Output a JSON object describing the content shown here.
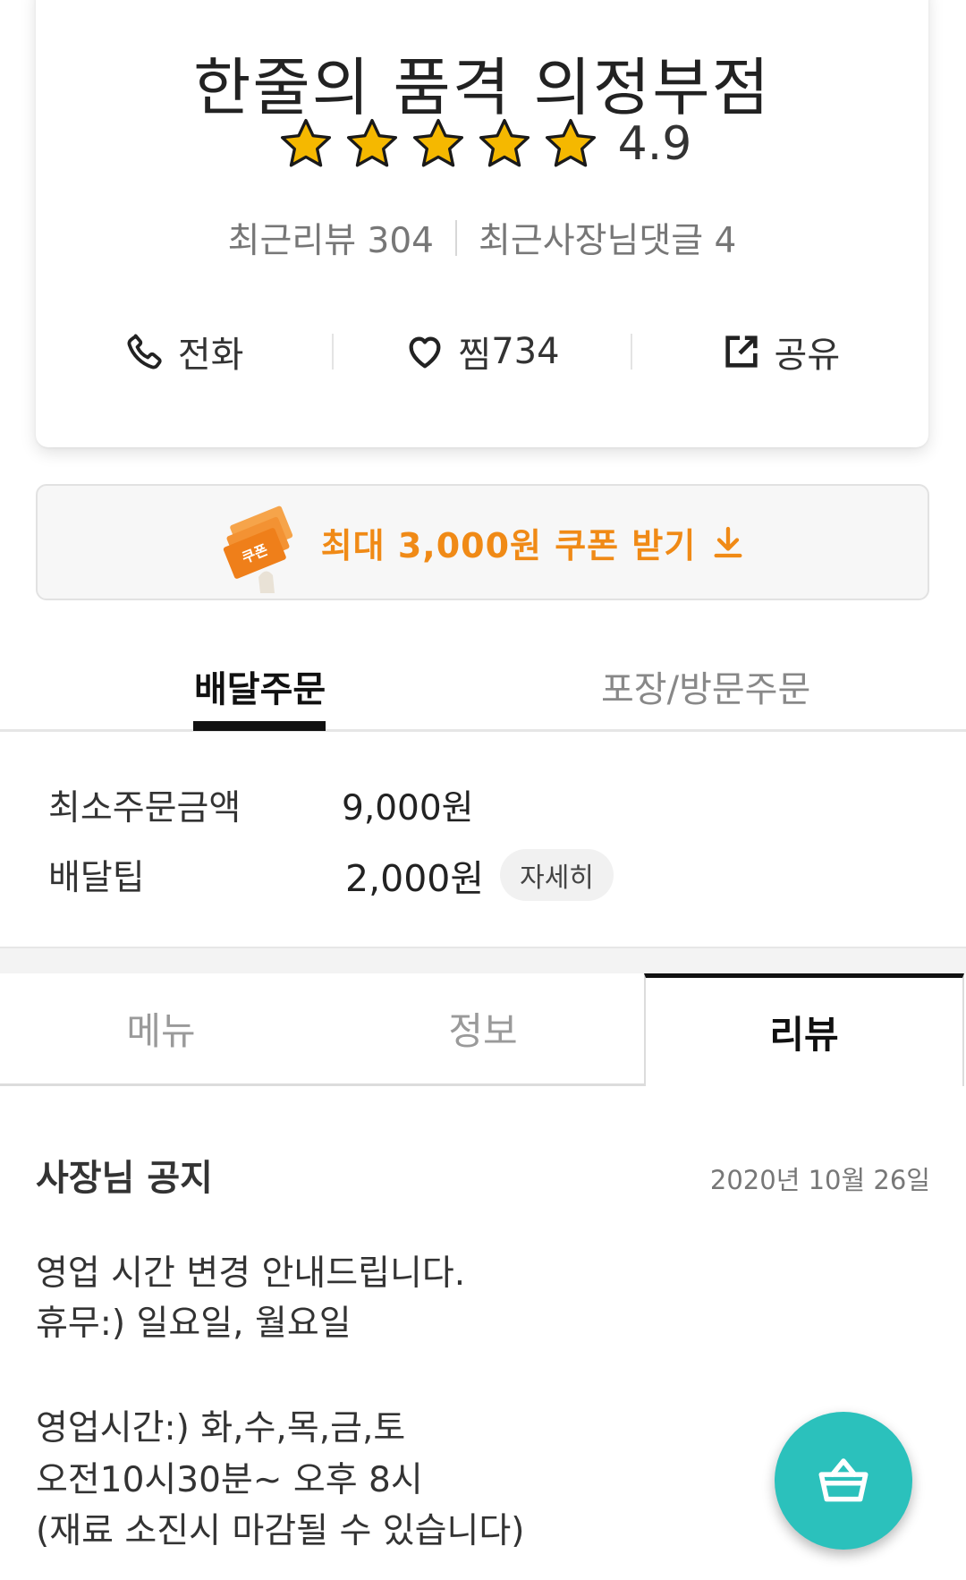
{
  "store": {
    "name": "한줄의 품격 의정부점",
    "rating": "4.9",
    "stars": 5,
    "recent_reviews": "최근리뷰 304",
    "owner_comments": "최근사장님댓글 4",
    "actions": {
      "call": "전화",
      "favorite": "찜",
      "favorite_count": "734",
      "share": "공유"
    }
  },
  "coupon": {
    "graphic_label": "쿠폰",
    "text": "최대 3,000원 쿠폰 받기",
    "accent_color": "#f08a16"
  },
  "order_tabs": {
    "delivery": "배달주문",
    "pickup": "포장/방문주문"
  },
  "delivery_info": {
    "min_order_label": "최소주문금액",
    "min_order_value": "9,000원",
    "tip_label": "배달팁",
    "tip_value": "2,000원",
    "detail_button": "자세히"
  },
  "section_tabs": {
    "menu": "메뉴",
    "info": "정보",
    "review": "리뷰",
    "active": "review"
  },
  "notice": {
    "title": "사장님 공지",
    "date": "2020년 10월 26일",
    "lines": [
      "영업 시간 변경 안내드립니다.",
      "휴무:) 일요일, 월요일",
      "영업시간:)  화,수,목,금,토",
      "오전10시30분~ 오후 8시",
      "(재료 소진시 마감될 수 있습니다)"
    ]
  },
  "colors": {
    "star": "#f5b800",
    "cart_fab": "#2bc1bc"
  },
  "icons": {
    "call": "phone-icon",
    "favorite": "heart-icon",
    "share": "share-icon",
    "coupon_download": "download-icon",
    "cart": "basket-icon"
  }
}
